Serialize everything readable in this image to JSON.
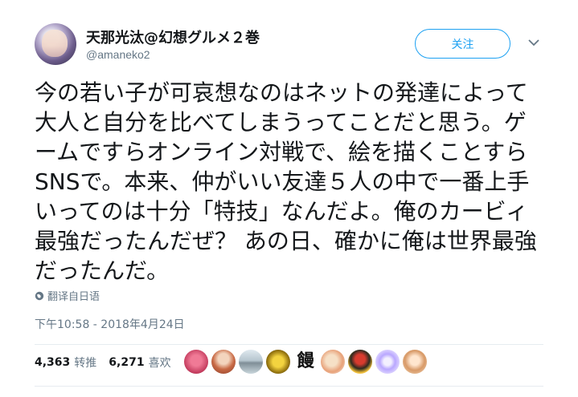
{
  "author": {
    "name": "天那光汰@幻想グルメ２巻",
    "handle": "@amaneko2"
  },
  "follow_label": "关注",
  "caret_icon": "chevron-down-icon",
  "tweet": {
    "text": "今の若い子が可哀想なのはネットの発達によって大人と自分を比べてしまうってことだと思う。ゲームですらオンライン対戦で、絵を描くことすらSNSで。本来、仲がいい友達５人の中で一番上手いってのは十分「特技」なんだよ。俺のカービィ最強だったんだぜ？ あの日、確かに俺は世界最強だったんだ。"
  },
  "translate_label": "翻译自日语",
  "timestamp": "下午10:58 - 2018年4月24日",
  "stats": {
    "retweets": "4,363",
    "retweets_label": "转推",
    "likes": "6,271",
    "likes_label": "喜欢"
  },
  "likers_glyph": "饅",
  "colors": {
    "accent": "#1da1f2",
    "muted": "#657786",
    "text": "#14171a"
  }
}
